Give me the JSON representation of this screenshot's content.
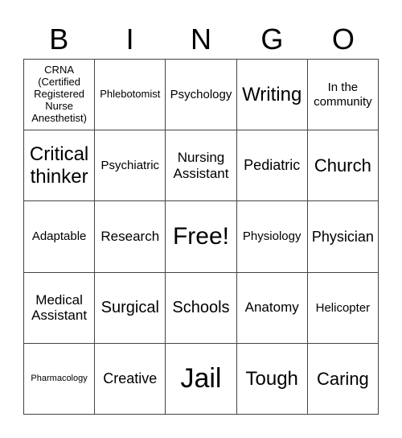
{
  "header": {
    "letters": [
      "B",
      "I",
      "N",
      "G",
      "O"
    ]
  },
  "cells": [
    [
      "CRNA (Certified Registered Nurse Anesthetist)",
      "Phlebotomist",
      "Psychology",
      "Writing",
      "In the community"
    ],
    [
      "Critical thinker",
      "Psychiatric",
      "Nursing Assistant",
      "Pediatric",
      "Church"
    ],
    [
      "Adaptable",
      "Research",
      "Free!",
      "Physiology",
      "Physician"
    ],
    [
      "Medical Assistant",
      "Surgical",
      "Schools",
      "Anatomy",
      "Helicopter"
    ],
    [
      "Pharmacology",
      "Creative",
      "Jail",
      "Tough",
      "Caring"
    ]
  ]
}
